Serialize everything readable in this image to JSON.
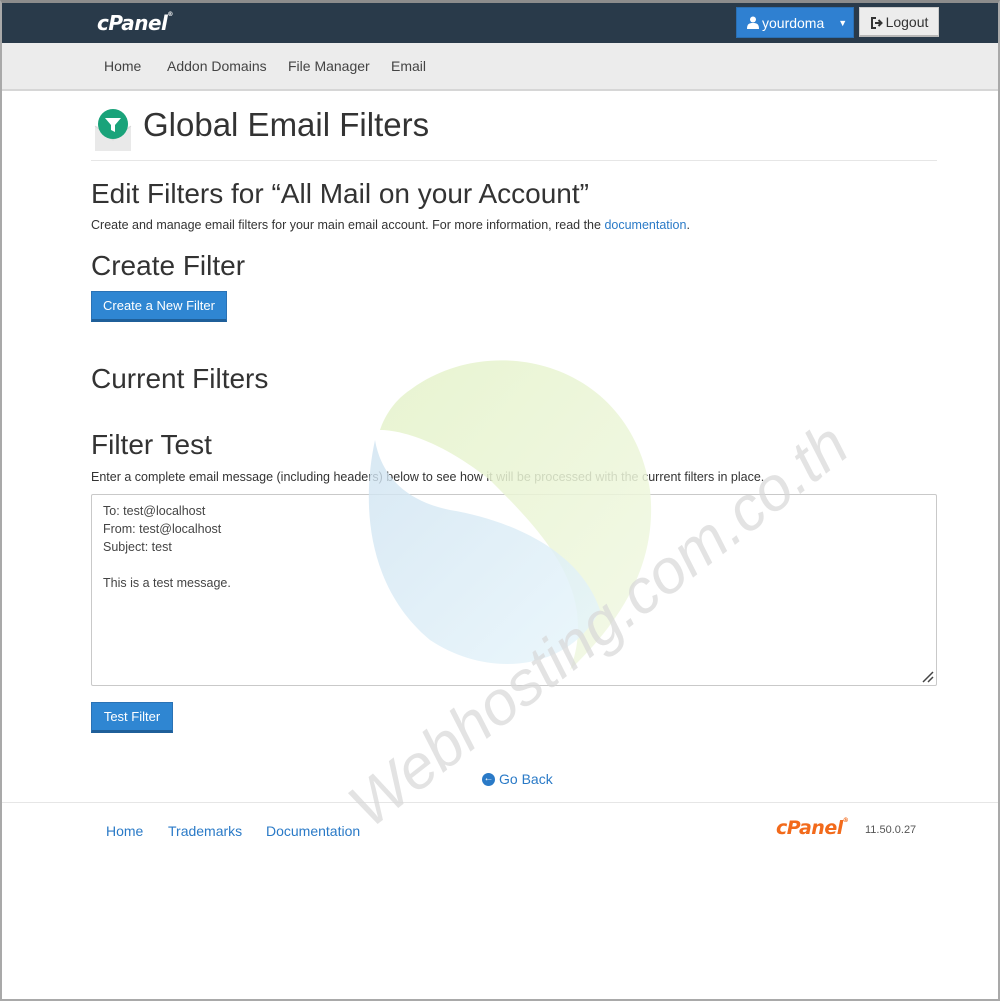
{
  "header": {
    "logo": "cPanel",
    "user_button": "yourdoma",
    "logout_button": "Logout"
  },
  "nav": {
    "items": [
      "Home",
      "Addon Domains",
      "File Manager",
      "Email"
    ]
  },
  "page": {
    "title": "Global Email Filters",
    "subtitle": "Edit Filters for “All Mail on your Account”",
    "description_prefix": "Create and manage email filters for your main email account. For more information, read the ",
    "description_link": "documentation",
    "description_suffix": "."
  },
  "create_filter": {
    "heading": "Create Filter",
    "button": "Create a New Filter"
  },
  "current_filters": {
    "heading": "Current Filters"
  },
  "filter_test": {
    "heading": "Filter Test",
    "description": "Enter a complete email message (including headers) below to see how it will be processed with the current filters in place.",
    "message": "To: test@localhost\nFrom: test@localhost\nSubject: test\n\nThis is a test message.",
    "button": "Test Filter"
  },
  "go_back": "Go Back",
  "footer": {
    "links": [
      "Home",
      "Trademarks",
      "Documentation"
    ],
    "logo": "cPanel",
    "version": "11.50.0.27"
  },
  "watermark": {
    "text": "Webhosting.com.co.th"
  },
  "colors": {
    "topbar": "#293a4a",
    "primary": "#2f86d2",
    "link": "#2a7ac7",
    "footer_logo": "#f26a1b"
  }
}
